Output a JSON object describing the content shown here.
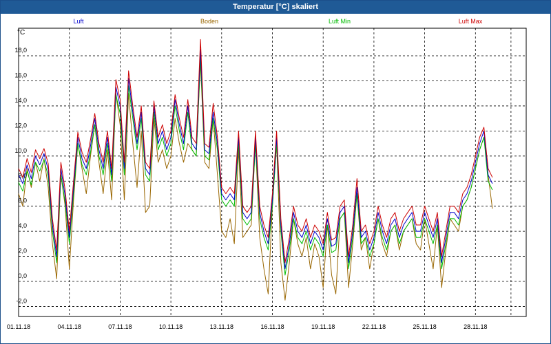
{
  "window": {
    "title": "Temperatur [°C] skaliert"
  },
  "chart_data": {
    "type": "line",
    "title": "Temperatur [°C] skaliert",
    "ylabel": "°C",
    "xlabel": "",
    "ylim": [
      -2.8,
      20.2
    ],
    "xlim": [
      0,
      30
    ],
    "grid": true,
    "legend_position": "top",
    "x_tick_values": [
      0,
      3,
      6,
      9,
      12,
      15,
      18,
      21,
      24,
      27
    ],
    "x_tick_labels": [
      "01.11.18",
      "04.11.18",
      "07.11.18",
      "10.11.18",
      "13.11.18",
      "16.11.18",
      "19.11.18",
      "22.11.18",
      "25.11.18",
      "28.11.18"
    ],
    "y_ticks": [
      -2.0,
      0.0,
      2.0,
      4.0,
      6.0,
      8.0,
      10.0,
      12.0,
      14.0,
      16.0,
      18.0
    ],
    "y_tick_labels": [
      "-2,0",
      "0,0",
      "2,0",
      "4,0",
      "6,0",
      "8,0",
      "10,0",
      "12,0",
      "14,0",
      "16,0",
      "18,0"
    ],
    "x": [
      0,
      0.25,
      0.5,
      0.75,
      1,
      1.25,
      1.5,
      1.75,
      2,
      2.25,
      2.5,
      2.75,
      3,
      3.25,
      3.5,
      3.75,
      4,
      4.25,
      4.5,
      4.75,
      5,
      5.25,
      5.5,
      5.75,
      6,
      6.25,
      6.5,
      6.75,
      7,
      7.25,
      7.5,
      7.75,
      8,
      8.25,
      8.5,
      8.75,
      9,
      9.25,
      9.5,
      9.75,
      10,
      10.25,
      10.5,
      10.75,
      11,
      11.25,
      11.5,
      11.75,
      12,
      12.25,
      12.5,
      12.75,
      13,
      13.25,
      13.5,
      13.75,
      14,
      14.25,
      14.5,
      14.75,
      15,
      15.25,
      15.5,
      15.75,
      16,
      16.25,
      16.5,
      16.75,
      17,
      17.25,
      17.5,
      17.75,
      18,
      18.25,
      18.5,
      18.75,
      19,
      19.25,
      19.5,
      19.75,
      20,
      20.25,
      20.5,
      20.75,
      21,
      21.25,
      21.5,
      21.75,
      22,
      22.25,
      22.5,
      22.75,
      23,
      23.25,
      23.5,
      23.75,
      24,
      24.25,
      24.5,
      24.75,
      25,
      25.25,
      25.5,
      25.75,
      26,
      26.25,
      26.5,
      26.75,
      27,
      27.25,
      27.5,
      27.75,
      28,
      28.25,
      28.5,
      28.75,
      29,
      29.25,
      29.5,
      29.75,
      30
    ],
    "series": [
      {
        "name": "Luft",
        "color": "#0000cc",
        "values": [
          8.5,
          7.8,
          9.3,
          8.2,
          10.0,
          9.3,
          10.2,
          8.9,
          4.5,
          2.0,
          9.0,
          6.8,
          3.5,
          7.5,
          11.5,
          9.8,
          9.0,
          10.8,
          13.0,
          10.5,
          9.0,
          11.5,
          8.5,
          15.5,
          14.0,
          9.0,
          16.2,
          13.5,
          11.0,
          13.5,
          9.0,
          8.5,
          14.0,
          11.0,
          12.0,
          10.5,
          11.5,
          14.5,
          12.5,
          11.0,
          14.0,
          11.0,
          10.5,
          18.5,
          10.5,
          10.2,
          13.5,
          11.0,
          7.0,
          6.5,
          7.0,
          6.5,
          11.5,
          5.5,
          5.0,
          5.5,
          11.5,
          5.5,
          4.0,
          3.0,
          6.5,
          11.5,
          4.5,
          1.0,
          3.0,
          5.5,
          4.0,
          3.5,
          4.5,
          3.0,
          4.0,
          3.5,
          2.5,
          5.0,
          2.8,
          3.0,
          5.5,
          6.0,
          1.5,
          4.0,
          7.5,
          3.5,
          4.0,
          2.5,
          3.5,
          5.5,
          4.0,
          3.0,
          4.5,
          5.0,
          3.5,
          4.5,
          5.0,
          5.5,
          4.0,
          4.0,
          5.5,
          4.5,
          3.5,
          5.0,
          1.5,
          3.5,
          5.5,
          5.5,
          5.0,
          6.5,
          7.0,
          8.0,
          9.5,
          11.0,
          12.0,
          8.5,
          7.8
        ]
      },
      {
        "name": "Boden",
        "color": "#996600",
        "values": [
          7.0,
          6.0,
          9.0,
          7.5,
          9.5,
          8.0,
          9.8,
          7.5,
          3.0,
          0.2,
          8.5,
          6.0,
          1.0,
          6.5,
          11.0,
          9.0,
          7.0,
          10.0,
          12.5,
          9.5,
          7.0,
          10.5,
          6.5,
          15.0,
          12.5,
          6.5,
          15.0,
          11.0,
          7.5,
          12.0,
          5.5,
          6.0,
          13.0,
          9.5,
          10.5,
          9.0,
          10.0,
          13.0,
          11.0,
          9.5,
          11.0,
          10.5,
          10.0,
          17.5,
          9.5,
          9.0,
          13.0,
          8.5,
          4.0,
          3.5,
          5.0,
          3.0,
          10.5,
          3.5,
          4.0,
          4.5,
          11.0,
          3.5,
          1.0,
          -1.0,
          6.0,
          11.0,
          1.5,
          -1.5,
          1.5,
          5.0,
          3.0,
          2.0,
          3.5,
          1.0,
          3.0,
          2.0,
          -0.5,
          4.5,
          0.5,
          -1.0,
          5.0,
          5.5,
          -0.5,
          3.0,
          7.0,
          2.5,
          3.5,
          1.0,
          3.0,
          5.0,
          3.0,
          2.0,
          4.0,
          4.5,
          2.5,
          4.0,
          4.5,
          5.0,
          3.0,
          2.5,
          5.0,
          3.0,
          1.0,
          4.5,
          -0.5,
          2.5,
          5.0,
          4.5,
          4.0,
          6.0,
          6.5,
          7.5,
          9.0,
          10.5,
          11.5,
          8.5,
          5.8
        ]
      },
      {
        "name": "Luft Min",
        "color": "#00bb00",
        "values": [
          7.9,
          7.2,
          8.8,
          7.7,
          9.5,
          8.8,
          9.7,
          8.4,
          4.0,
          1.5,
          8.5,
          6.3,
          3.0,
          7.0,
          11.0,
          9.3,
          8.5,
          10.3,
          12.5,
          10.0,
          8.5,
          11.0,
          8.0,
          14.9,
          13.4,
          8.5,
          15.6,
          13.0,
          10.5,
          13.0,
          8.5,
          8.0,
          13.5,
          10.5,
          11.5,
          10.0,
          11.0,
          14.0,
          12.0,
          10.5,
          13.5,
          10.5,
          10.0,
          17.9,
          10.0,
          9.7,
          13.0,
          10.5,
          6.5,
          6.0,
          6.5,
          6.0,
          11.0,
          5.0,
          4.5,
          5.0,
          11.0,
          5.0,
          3.5,
          2.5,
          6.0,
          11.0,
          4.0,
          0.5,
          2.5,
          5.0,
          3.5,
          3.0,
          4.0,
          2.5,
          3.5,
          3.0,
          2.0,
          4.5,
          2.3,
          2.5,
          5.0,
          5.5,
          1.0,
          3.5,
          7.0,
          3.0,
          3.5,
          2.0,
          3.0,
          5.0,
          3.5,
          2.5,
          4.0,
          4.5,
          3.0,
          4.0,
          4.5,
          5.0,
          3.5,
          3.5,
          5.0,
          4.0,
          3.0,
          4.5,
          1.0,
          3.0,
          5.0,
          5.0,
          4.5,
          6.0,
          6.5,
          7.5,
          9.0,
          10.5,
          11.5,
          8.0,
          7.3
        ]
      },
      {
        "name": "Luft Max",
        "color": "#cc0000",
        "values": [
          9.0,
          8.3,
          9.8,
          8.7,
          10.5,
          9.8,
          10.6,
          9.4,
          5.0,
          2.5,
          9.5,
          7.3,
          4.0,
          8.0,
          11.9,
          10.3,
          9.5,
          11.3,
          13.4,
          11.0,
          9.5,
          12.0,
          9.0,
          16.1,
          14.5,
          9.5,
          16.8,
          14.0,
          11.5,
          14.0,
          9.5,
          9.0,
          14.4,
          11.5,
          12.5,
          11.0,
          12.0,
          14.9,
          13.0,
          11.5,
          14.5,
          11.5,
          11.0,
          19.3,
          11.0,
          10.7,
          14.2,
          11.5,
          7.5,
          7.0,
          7.5,
          7.0,
          12.0,
          6.0,
          5.5,
          6.0,
          12.0,
          6.0,
          4.5,
          3.5,
          7.0,
          12.0,
          5.0,
          1.5,
          3.5,
          6.0,
          4.5,
          4.0,
          5.0,
          3.5,
          4.5,
          4.0,
          3.0,
          5.5,
          3.3,
          3.5,
          6.0,
          6.5,
          2.0,
          4.5,
          8.2,
          4.0,
          4.5,
          3.0,
          4.0,
          6.0,
          4.5,
          3.5,
          5.0,
          5.5,
          4.0,
          5.0,
          5.5,
          6.0,
          4.5,
          4.5,
          6.0,
          5.0,
          4.0,
          5.5,
          2.0,
          4.0,
          6.0,
          6.0,
          5.5,
          7.0,
          7.5,
          8.5,
          10.0,
          11.5,
          12.3,
          9.0,
          8.3
        ]
      }
    ]
  }
}
